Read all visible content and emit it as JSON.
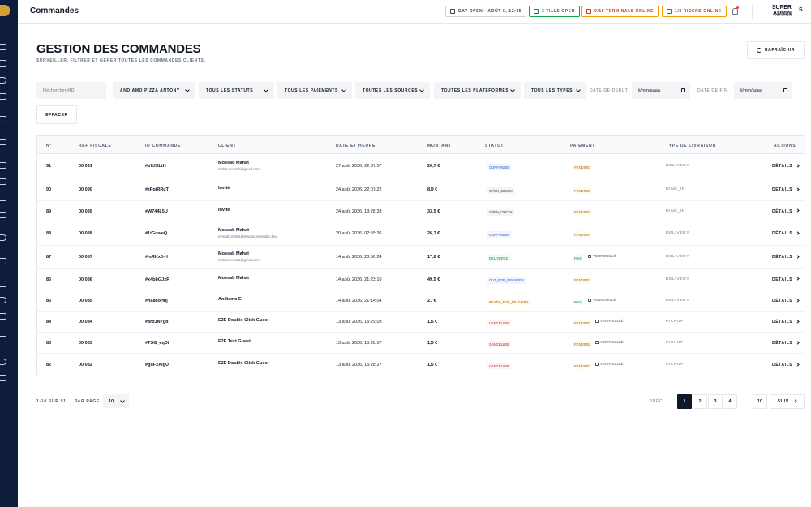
{
  "header": {
    "title": "Commandes",
    "day_status": "DAY OPEN · AOÛT 6, 12:35",
    "tills": "3 TILLS OPEN",
    "terminals": "0/18 TERMINALS ONLINE",
    "riders": "1/8 RIDERS ONLINE",
    "user_name": "SUPER ADMIN",
    "user_role": "KITCHEN",
    "avatar_initial": "S"
  },
  "page": {
    "title": "GESTION DES COMMANDES",
    "subtitle": "SURVEILLER, FILTRER ET GÉRER TOUTES LES COMMANDES CLIENTS.",
    "refresh_label": "RAFRAÎCHIR"
  },
  "filters": {
    "search_placeholder": "Rechercher #ID",
    "restaurant": "ANDIAMO PIZZA ANTONY",
    "status": "TOUS LES STATUTS",
    "payments": "TOUS LES PAIEMENTS",
    "sources": "TOUTES LES SOURCES",
    "platforms": "TOUTES LES PLATEFORMES",
    "types": "TOUS LES TYPES",
    "start_label": "DATE DE DÉBUT",
    "start_value": "jj/mm/aaaa",
    "end_label": "DATE DE FIN",
    "end_value": "jj/mm/aaaa",
    "clear_label": "EFFACER"
  },
  "table": {
    "columns": {
      "num": "N°",
      "ref": "RÉF FISCALE",
      "id": "ID COMMANDE",
      "client": "CLIENT",
      "date": "DATE ET HEURE",
      "amount": "MONTANT",
      "status": "STATUT",
      "payment": "PAIEMENT",
      "delivery": "TYPE DE LIVRAISON",
      "actions": "ACTIONS"
    },
    "action_label": "DÉTAILS",
    "lock_label": "VERROUILLÉ",
    "rows": [
      {
        "num": "91",
        "ref": "00 091",
        "id": "#a7tfXLtH",
        "name": "Mossab Mahat",
        "email": "mahat.mossab@gmail.com",
        "date": "27 août 2026, 22:37:57",
        "amount": "20,7 €",
        "status": "CONFIRMED",
        "payment": "PENDING",
        "locked": false,
        "delivery": "DELIVERY"
      },
      {
        "num": "90",
        "ref": "00 090",
        "id": "#zPpjRRuT",
        "name": "Invité",
        "email": "",
        "date": "24 août 2026, 22:07:22",
        "amount": "8,9 €",
        "status": "OPEN_CHECK",
        "payment": "PENDING",
        "locked": false,
        "delivery": "DINE_IN"
      },
      {
        "num": "89",
        "ref": "00 089",
        "id": "#W744L5U",
        "name": "Invité",
        "email": "",
        "date": "24 août 2026, 13:28:33",
        "amount": "33,5 €",
        "status": "OPEN_CHECK",
        "payment": "PENDING",
        "locked": false,
        "delivery": "DINE_IN"
      },
      {
        "num": "88",
        "ref": "00 088",
        "id": "#1tGuweQ",
        "name": "Mossab Mahat",
        "email": "mossab.mahat@maolog.mossabin.dev",
        "date": "20 août 2026, 02:55:36",
        "amount": "26,7 €",
        "status": "CONFIRMED",
        "payment": "PENDING",
        "locked": false,
        "delivery": "DELIVERY"
      },
      {
        "num": "87",
        "ref": "00 087",
        "id": "#-sRKx0-H",
        "name": "Mossab Mahat",
        "email": "mahat.mossab@gmail.com",
        "date": "14 août 2026, 23:56:24",
        "amount": "17,8 €",
        "status": "DELIVERED",
        "payment": "PAID",
        "locked": true,
        "delivery": "DELIVERY"
      },
      {
        "num": "86",
        "ref": "00 086",
        "id": "#x4bbGJxR",
        "name": "Mossab Mahat",
        "email": "",
        "date": "14 août 2026, 21:23:10",
        "amount": "49,5 €",
        "status": "OUT_FOR_DELIVERY",
        "payment": "PENDING",
        "locked": false,
        "delivery": "DELIVERY"
      },
      {
        "num": "85",
        "ref": "00 085",
        "id": "#ha88oHuj",
        "name": "Andiamo E.",
        "email": "",
        "date": "14 août 2026, 21:14:04",
        "amount": "21 €",
        "status": "READY_FOR_DELIVERY",
        "payment": "PAID",
        "locked": true,
        "delivery": "DELIVERY"
      },
      {
        "num": "84",
        "ref": "00 084",
        "id": "#8rd1N7gd",
        "name": "E2E Double Click Guest",
        "email": "",
        "date": "13 août 2026, 15:29:03",
        "amount": "1,5 €",
        "status": "CANCELLED",
        "payment": "PENDING",
        "locked": true,
        "delivery": "PICKUP"
      },
      {
        "num": "83",
        "ref": "00 083",
        "id": "#TSG_eqDi",
        "name": "E2E Test Guest",
        "email": "",
        "date": "13 août 2026, 15:28:57",
        "amount": "1,5 €",
        "status": "CANCELLED",
        "payment": "PENDING",
        "locked": true,
        "delivery": "PICKUP"
      },
      {
        "num": "82",
        "ref": "00 082",
        "id": "#gdF2AlgU",
        "name": "E2E Double Click Guest",
        "email": "",
        "date": "13 août 2026, 15:28:27",
        "amount": "1,5 €",
        "status": "CANCELLED",
        "payment": "PENDING",
        "locked": true,
        "delivery": "PICKUP"
      }
    ]
  },
  "footer": {
    "range": "1-10 SUR 91",
    "per_page_label": "PAR PAGE",
    "per_page_value": "10",
    "prev": "PRÉC.",
    "pages": [
      "1",
      "2",
      "3",
      "4"
    ],
    "ellipsis": "...",
    "last_page": "10",
    "next": "SUIV."
  }
}
